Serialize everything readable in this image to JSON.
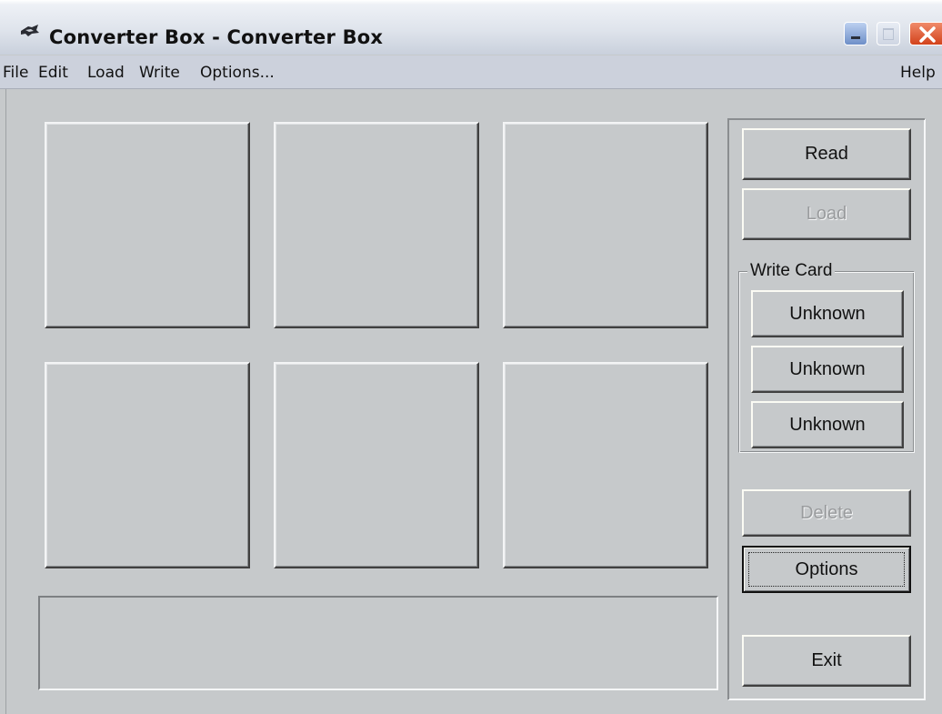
{
  "window": {
    "title": "Converter Box - Converter Box"
  },
  "menu": {
    "file": "File",
    "edit": "Edit",
    "load": "Load",
    "write": "Write",
    "options": "Options...",
    "help": "Help"
  },
  "status": {
    "text": ""
  },
  "buttons": {
    "read": "Read",
    "load": "Load",
    "write_card_group": "Write Card",
    "write_slots": [
      "Unknown",
      "Unknown",
      "Unknown"
    ],
    "delete": "Delete",
    "options": "Options",
    "exit": "Exit"
  },
  "icons": {
    "app": "converter-box-app-icon",
    "minimize": "minimize-icon",
    "maximize": "maximize-icon",
    "close": "close-icon"
  },
  "colors": {
    "face": "#c6c9cb",
    "close_red": "#d2431c",
    "menubar": "#ccd1dc"
  }
}
